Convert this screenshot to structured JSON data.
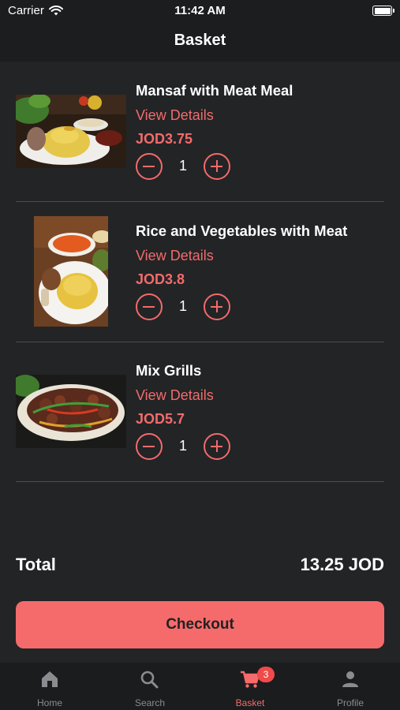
{
  "status_bar": {
    "carrier": "Carrier",
    "time": "11:42 AM"
  },
  "header": {
    "title": "Basket"
  },
  "items": [
    {
      "name": "Mansaf with Meat Meal",
      "details_label": "View Details",
      "price": "JOD3.75",
      "quantity": "1"
    },
    {
      "name": "Rice and Vegetables with Meat",
      "details_label": "View Details",
      "price": "JOD3.8",
      "quantity": "1"
    },
    {
      "name": "Mix Grills",
      "details_label": "View Details",
      "price": "JOD5.7",
      "quantity": "1"
    }
  ],
  "summary": {
    "total_label": "Total",
    "total_value": "13.25 JOD"
  },
  "checkout": {
    "label": "Checkout"
  },
  "tabbar": {
    "tabs": [
      {
        "label": "Home",
        "icon": "home-icon"
      },
      {
        "label": "Search",
        "icon": "search-icon"
      },
      {
        "label": "Basket",
        "icon": "cart-icon",
        "badge": "3",
        "active": true
      },
      {
        "label": "Profile",
        "icon": "person-icon"
      }
    ]
  },
  "colors": {
    "accent": "#f56b6b",
    "background": "#232426",
    "bar": "#1c1d1f",
    "divider": "#4c4d50"
  }
}
